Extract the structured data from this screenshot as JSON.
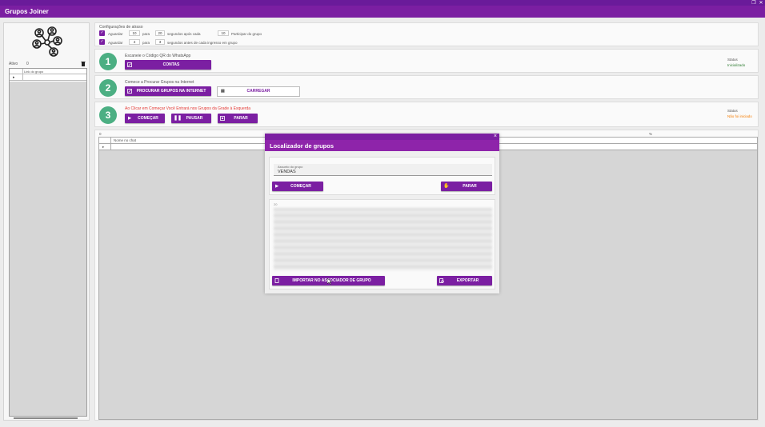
{
  "app": {
    "title": "Grupos Joiner"
  },
  "left": {
    "ativo_label": "Ativo",
    "ativo_count": "0",
    "table_header": "Link do grupo",
    "row_arrow": "▸"
  },
  "config": {
    "title": "Configurações de atraso",
    "row1": {
      "label": "Aguardar",
      "from": "10",
      "para": "para",
      "to": "20",
      "text": "segundos após cada",
      "count": "10",
      "tail": "Participar do grupo"
    },
    "row2": {
      "label": "Aguardar",
      "from": "4",
      "para": "para",
      "to": "3",
      "text": "segundos antes de cada ingresso em grupo"
    }
  },
  "steps": [
    {
      "number": "1",
      "text": "Escaneie o Código QR do WhatsApp",
      "button": "CONTAS",
      "status_label": "Status",
      "status_value": "Inicializado",
      "status_color": "#2e7d32"
    },
    {
      "number": "2",
      "text": "Comece a Procurar Grupos na Internet",
      "button": "PROCURAR GRUPOS NA INTERNET",
      "outline_button": "CARREGAR"
    },
    {
      "number": "3",
      "text": "Ao Clicar em Começar Você Entrará nos Grupos da Grade à Esquerda",
      "buttons": [
        "COMEÇAR",
        "PAUSAR",
        "PARAR"
      ],
      "status_label": "Status",
      "status_value": "Não foi iniciado",
      "status_color": "#f57c00"
    }
  ],
  "grid": {
    "count": "0",
    "percent": "%",
    "header": "Nome no chat",
    "row_arrow": "▸"
  },
  "dialog": {
    "title": "Localizador de grupos",
    "close": "×",
    "field_label": "Assunto do grupo",
    "field_value": "VENDAS",
    "start_button": "COMEÇAR",
    "stop_button": "PARAR",
    "results_count": "20",
    "import_button": "IMPORTAR NO ASSOCIADOR DE GRUPO",
    "export_button": "EXPORTAR"
  },
  "colors": {
    "accent": "#7b1fa2",
    "step_green": "#4caf83",
    "warning_red": "#e53935"
  }
}
